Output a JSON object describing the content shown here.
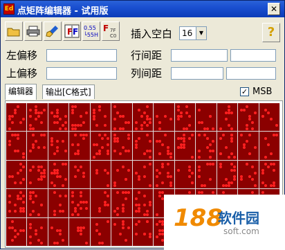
{
  "window": {
    "title": "点矩阵编辑器 - 试用版",
    "close_label": "✕"
  },
  "toolbar": {
    "buttons": [
      {
        "name": "open-folder-icon",
        "glyph": "📂"
      },
      {
        "name": "print-icon",
        "glyph": "🖨"
      },
      {
        "name": "clear-brush-icon",
        "glyph": "🖌"
      },
      {
        "name": "flip-icon",
        "glyph": "F"
      },
      {
        "name": "size-55-icon",
        "glyph": "0.55"
      },
      {
        "name": "font-convert-icon",
        "glyph": "F"
      }
    ],
    "insert_space_label": "插入空白",
    "insert_space_value": "16",
    "help_label": "?"
  },
  "offsets": {
    "left_label": "左偏移",
    "up_label": "上偏移",
    "row_spacing_label": "行间距",
    "col_spacing_label": "列间距"
  },
  "tabs": [
    {
      "label": "编辑器",
      "active": true
    },
    {
      "label": "输出[C格式]",
      "active": false
    }
  ],
  "msb": {
    "label": "MSB",
    "checked": "✓"
  },
  "watermark": {
    "logo": "188",
    "name": "软件园",
    "url": "soft.com"
  },
  "colors": {
    "grid_bg": "#8b0000",
    "dot": "#ff2020",
    "grid_line": "#e0e0e0"
  }
}
